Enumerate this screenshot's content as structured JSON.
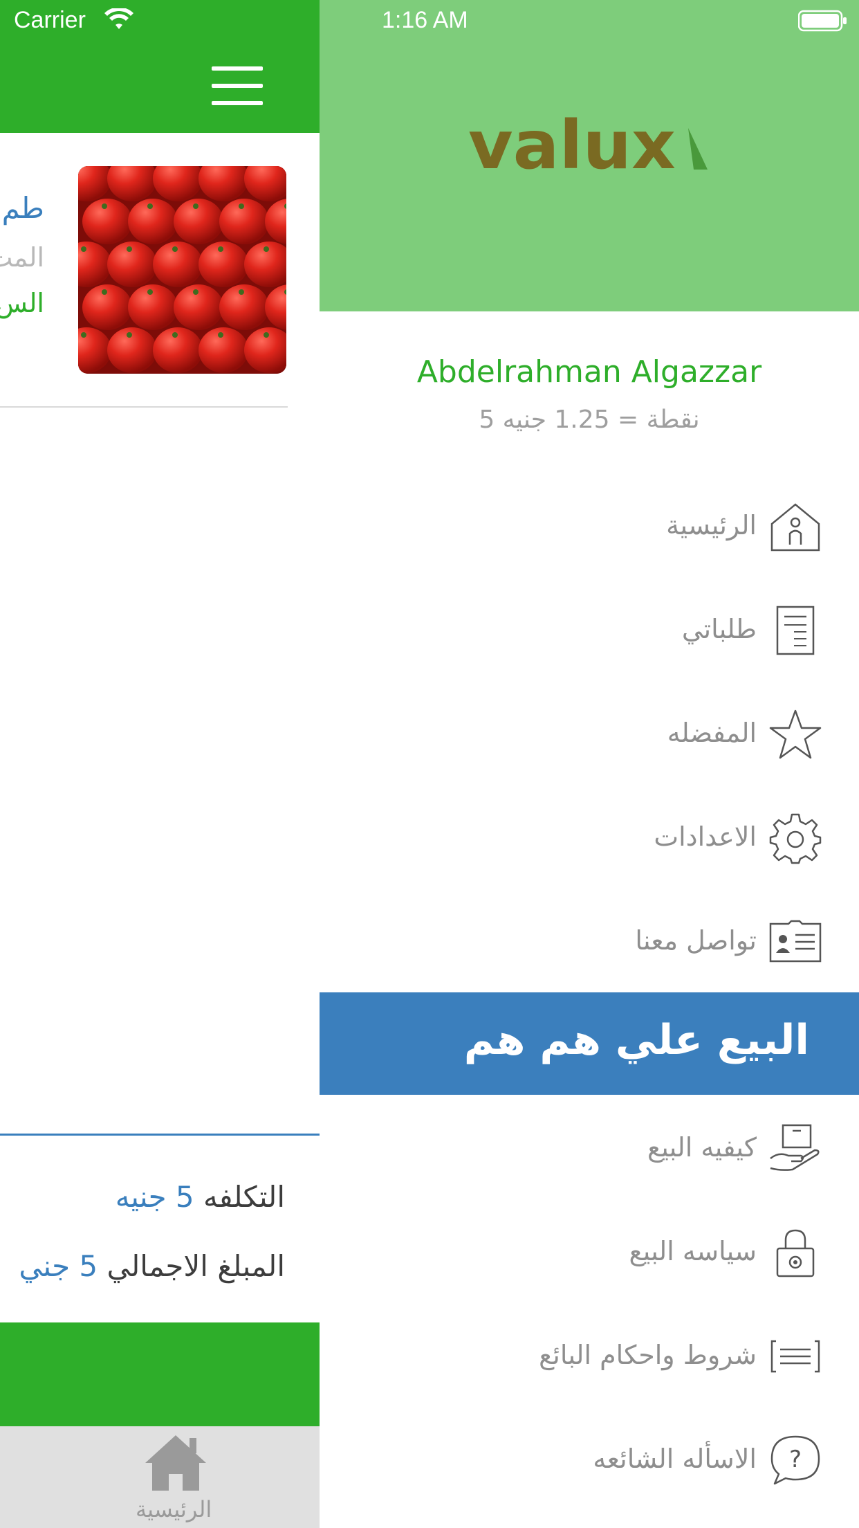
{
  "status_bar": {
    "carrier": "Carrier",
    "time": "1:16 AM"
  },
  "background_screen": {
    "product": {
      "title": "طم",
      "subtitle": "المت",
      "price": "الس"
    },
    "summary": {
      "cost_label": "التكلفه",
      "cost_value": "5 جنيه",
      "total_label": "المبلغ الاجمالي",
      "total_value": "5 جني"
    },
    "tab_bar": {
      "home_label": "الرئيسية"
    }
  },
  "drawer": {
    "logo_text": "valux",
    "user_name": "Abdelrahman Algazzar",
    "points": "5 نقطة = 1.25 جنيه",
    "menu_items": [
      {
        "label": "الرئيسية",
        "icon": "home-person-icon"
      },
      {
        "label": "طلباتي",
        "icon": "document-list-icon"
      },
      {
        "label": "المفضله",
        "icon": "star-icon"
      },
      {
        "label": "الاعدادات",
        "icon": "gear-icon"
      },
      {
        "label": "تواصل معنا",
        "icon": "contact-card-icon"
      }
    ],
    "section_title": "البيع علي هم هم",
    "sell_items": [
      {
        "label": "كيفيه البيع",
        "icon": "hand-box-icon"
      },
      {
        "label": "سياسه البيع",
        "icon": "lock-icon"
      },
      {
        "label": "شروط واحكام البائع",
        "icon": "terms-icon"
      },
      {
        "label": "الاسأله الشائعه",
        "icon": "question-bubble-icon"
      }
    ]
  },
  "colors": {
    "green_primary": "#2eae2a",
    "green_header": "#7ecd7b",
    "blue_accent": "#3b7fbd",
    "menu_text_gray": "#8e8e8e",
    "logo_olive": "#7a6a22"
  }
}
